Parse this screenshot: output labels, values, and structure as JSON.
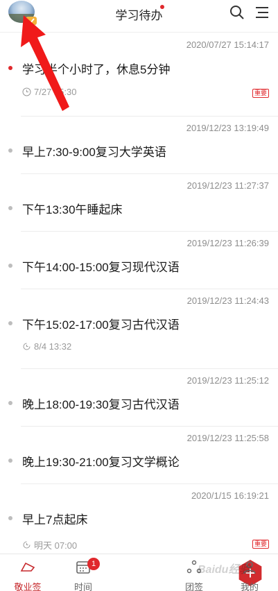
{
  "header": {
    "title": "学习待办",
    "avatar_icon": "landscape-avatar",
    "badge_icon": "vip-check-badge",
    "search_icon": "search-icon",
    "menu_icon": "menu-icon",
    "accent_color": "#e0282c"
  },
  "todos": [
    {
      "timestamp": "2020/07/27 15:14:17",
      "title": "学习半个小时了，休息5分钟",
      "meta": "7/27 15:30",
      "meta_icon": "clock-icon",
      "tag": "重要",
      "bullet": "red"
    },
    {
      "timestamp": "2019/12/23 13:19:49",
      "title": "早上7:30-9:00复习大学英语",
      "meta": "",
      "meta_icon": "",
      "tag": "",
      "bullet": "gray"
    },
    {
      "timestamp": "2019/12/23 11:27:37",
      "title": "下午13:30午睡起床",
      "meta": "",
      "meta_icon": "",
      "tag": "",
      "bullet": "gray"
    },
    {
      "timestamp": "2019/12/23 11:26:39",
      "title": "下午14:00-15:00复习现代汉语",
      "meta": "",
      "meta_icon": "",
      "tag": "",
      "bullet": "gray"
    },
    {
      "timestamp": "2019/12/23 11:24:43",
      "title": "下午15:02-17:00复习古代汉语",
      "meta": "8/4 13:32",
      "meta_icon": "repeat-clock-icon",
      "tag": "",
      "bullet": "gray"
    },
    {
      "timestamp": "2019/12/23 11:25:12",
      "title": "晚上18:00-19:30复习古代汉语",
      "meta": "",
      "meta_icon": "",
      "tag": "",
      "bullet": "gray"
    },
    {
      "timestamp": "2019/12/23 11:25:58",
      "title": "晚上19:30-21:00复习文学概论",
      "meta": "",
      "meta_icon": "",
      "tag": "",
      "bullet": "gray"
    },
    {
      "timestamp": "2020/1/15 16:19:21",
      "title": "早上7点起床",
      "meta": "明天 07:00",
      "meta_icon": "repeat-clock-icon",
      "tag": "重要",
      "bullet": "gray"
    }
  ],
  "tabbar": {
    "tabs": [
      {
        "label": "敬业签",
        "icon": "sign-icon",
        "active": true
      },
      {
        "label": "时间",
        "icon": "calendar-icon",
        "badge": "1"
      },
      {
        "label": "",
        "icon": "add-icon"
      },
      {
        "label": "团签",
        "icon": "team-icon"
      },
      {
        "label": "我的",
        "icon": "profile-icon"
      }
    ],
    "add_label": "+",
    "watermark": "Baidu经验"
  }
}
